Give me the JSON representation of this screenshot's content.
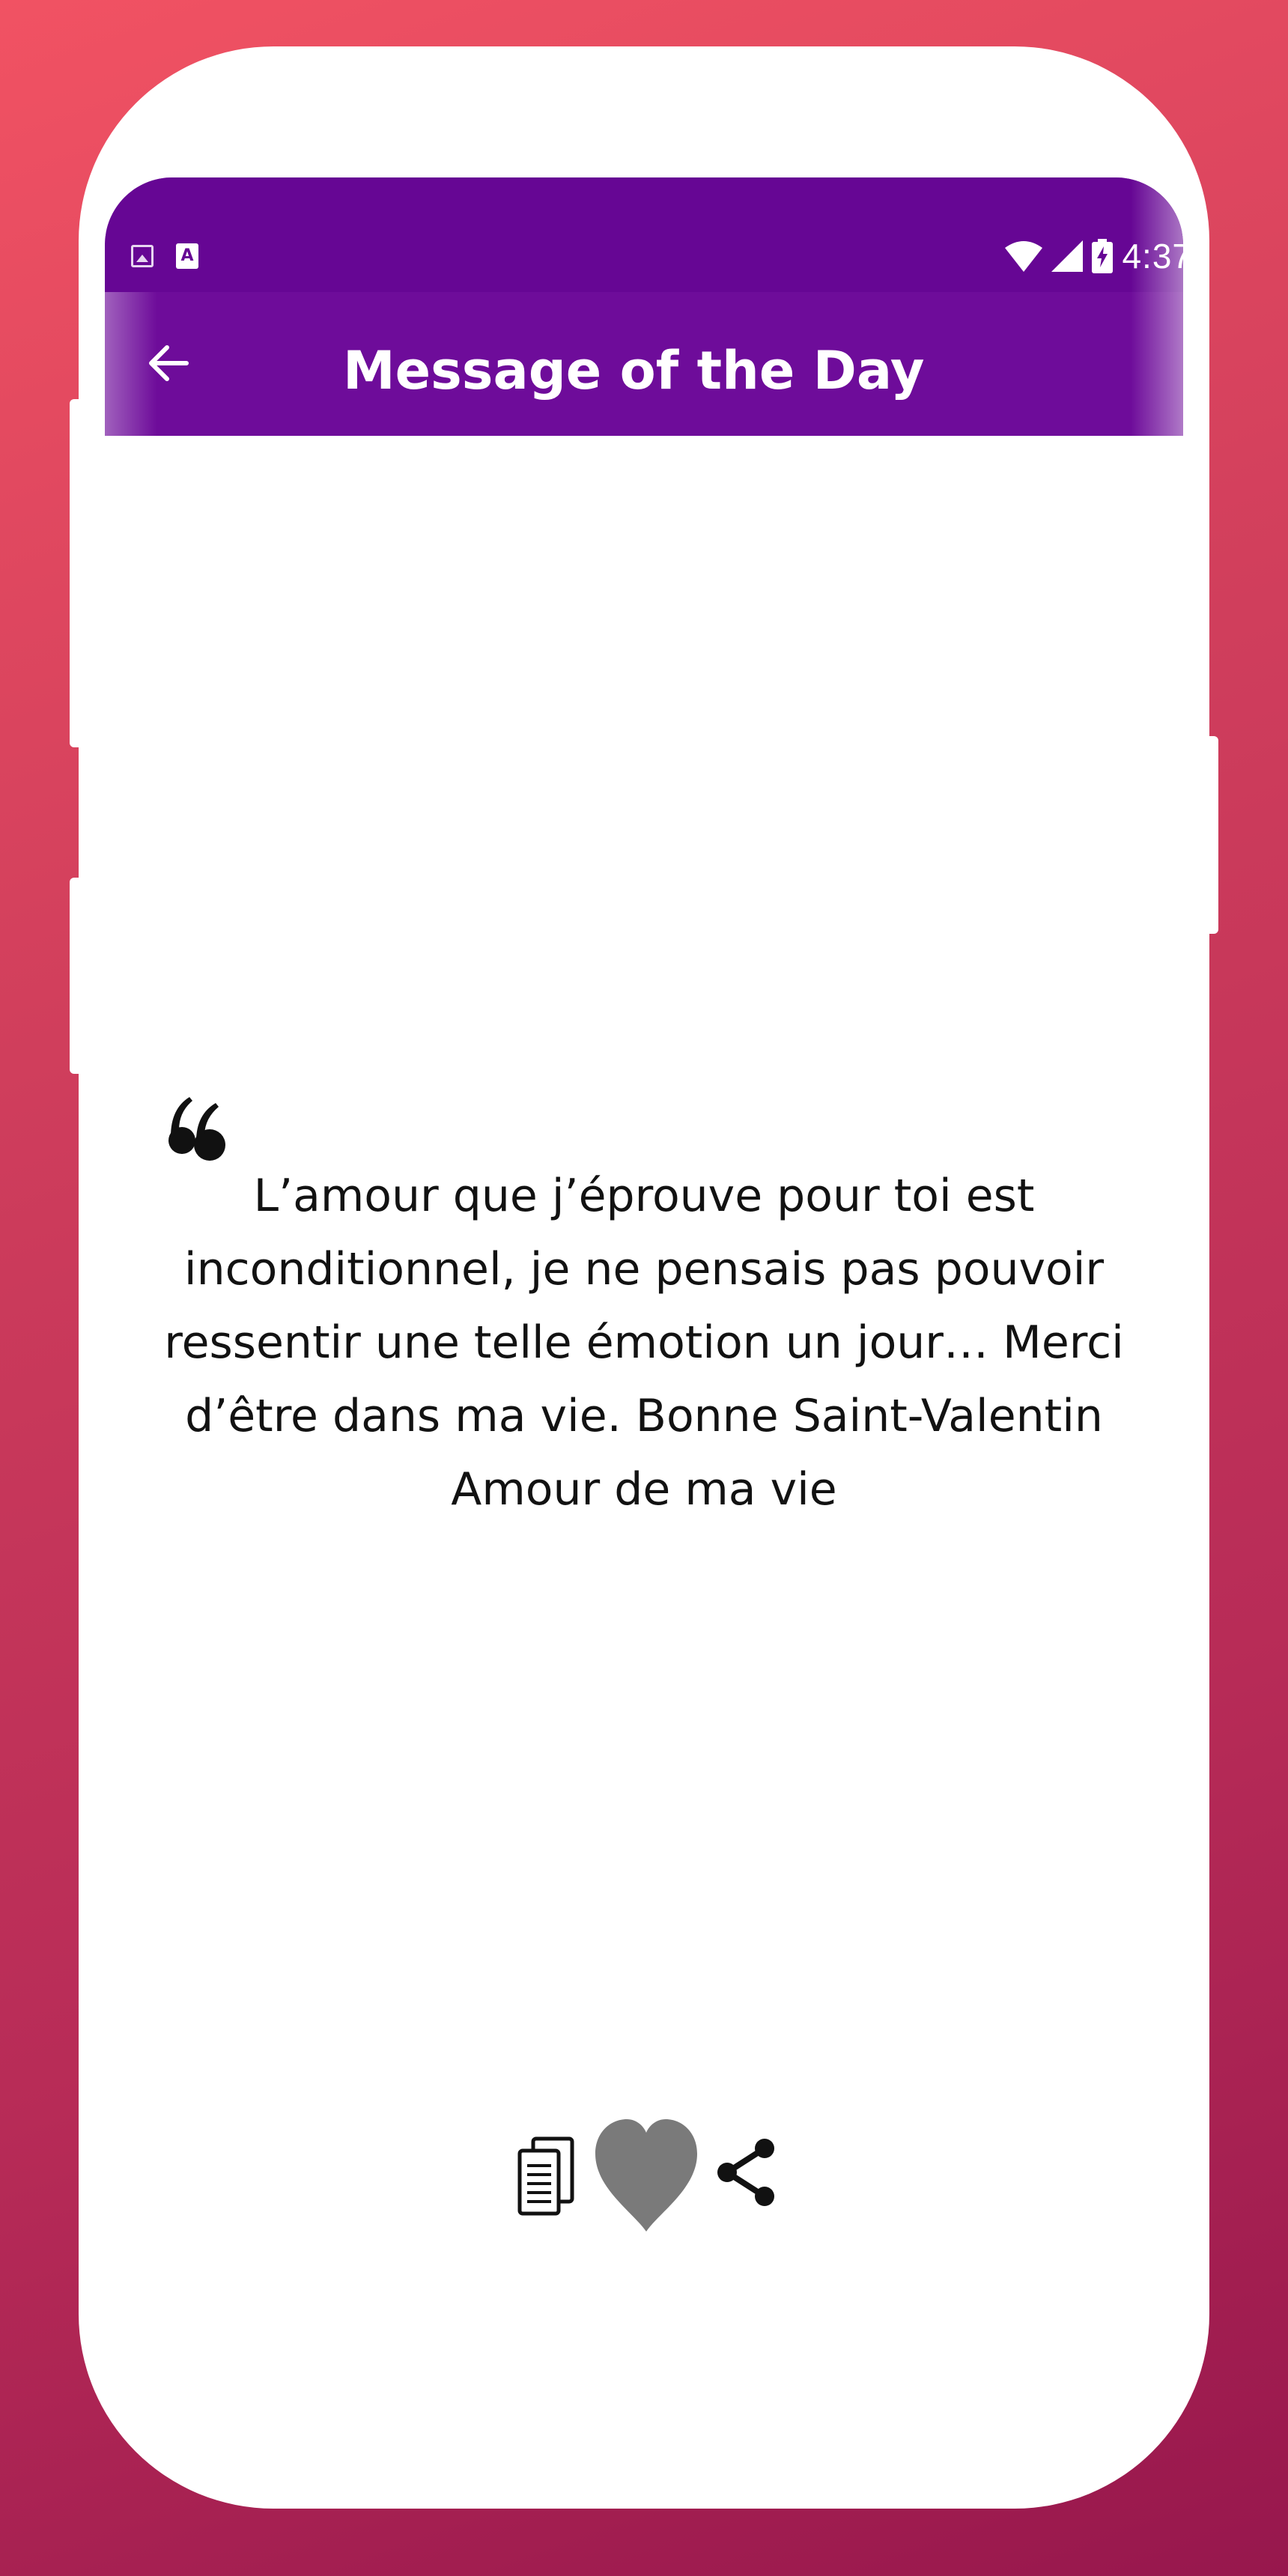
{
  "status_bar": {
    "time": "4:37",
    "icons": [
      "image-icon",
      "a-icon",
      "wifi-icon",
      "signal-icon",
      "battery-icon"
    ]
  },
  "toolbar": {
    "title": "Message of the Day",
    "back_icon": "arrow-left-icon"
  },
  "message": {
    "quote_icon": "quote-icon",
    "text": "L’amour que j’éprouve pour toi est inconditionnel, je ne pensais pas pouvoir ressentir une telle émotion un jour… Merci d’être dans ma vie. Bonne Saint-Valentin Amour de ma vie"
  },
  "actions": {
    "copy_icon": "copy-icon",
    "like_icon": "heart-icon",
    "share_icon": "share-icon"
  },
  "colors": {
    "status_bar": "#660694",
    "toolbar": "#6e0c9a",
    "background_top": "#f15263",
    "background_bottom": "#97174d",
    "heart": "#7a7a7a",
    "text": "#121212"
  }
}
